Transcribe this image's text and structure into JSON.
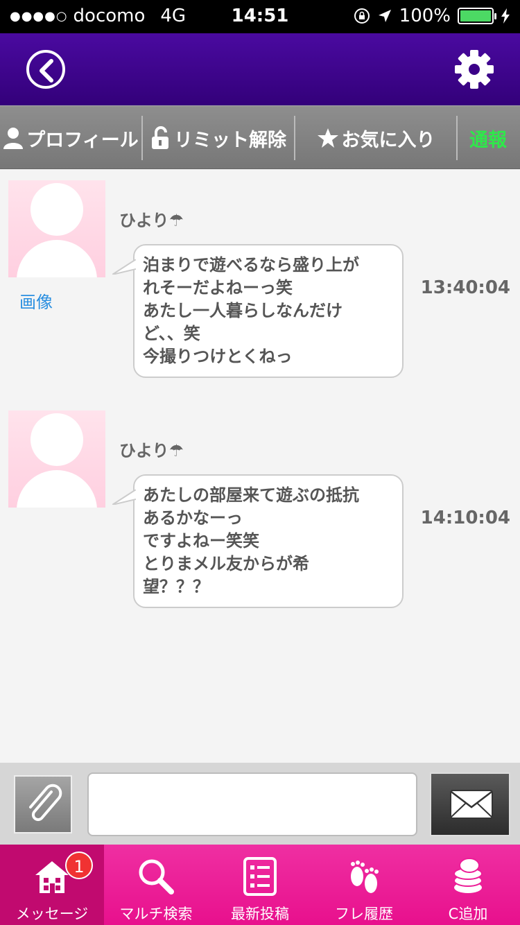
{
  "status_bar": {
    "carrier": "docomo",
    "network": "4G",
    "time": "14:51",
    "battery": "100%",
    "battery_level": 1.0
  },
  "tabs": [
    {
      "label": "プロフィール",
      "icon": "person-icon"
    },
    {
      "label": "リミット解除",
      "icon": "unlock-icon"
    },
    {
      "label": "お気に入り",
      "icon": "star-icon"
    },
    {
      "label": "通報",
      "icon": ""
    }
  ],
  "messages": [
    {
      "sender": "ひより☂",
      "image_link": "画像",
      "lines": [
        "泊まりで遊べるなら盛り上が",
        "れそーだよねーっ笑",
        "あたし一人暮らしなんだけ",
        "ど、、笑",
        "今撮りつけとくねっ"
      ],
      "time": "13:40:04"
    },
    {
      "sender": "ひより☂",
      "lines": [
        "あたしの部屋来て遊ぶの抵抗",
        "あるかなーっ",
        "ですよねー笑笑",
        "とりまメル友からが希",
        "望？？？"
      ],
      "time": "14:10:04"
    }
  ],
  "input": {
    "value": "",
    "placeholder": ""
  },
  "bottom_nav": [
    {
      "label": "メッセージ",
      "icon": "house-icon",
      "badge": "1"
    },
    {
      "label": "マルチ検索",
      "icon": "magnifier-icon"
    },
    {
      "label": "最新投稿",
      "icon": "list-icon"
    },
    {
      "label": "フレ履歴",
      "icon": "footprints-icon"
    },
    {
      "label": "C追加",
      "icon": "coins-icon"
    }
  ],
  "colors": {
    "header": "#3b0088",
    "nav_pink": "#ec1e97",
    "nav_active": "#c10a6f",
    "report_green": "#2ee84a",
    "link_blue": "#2a8fe0"
  }
}
